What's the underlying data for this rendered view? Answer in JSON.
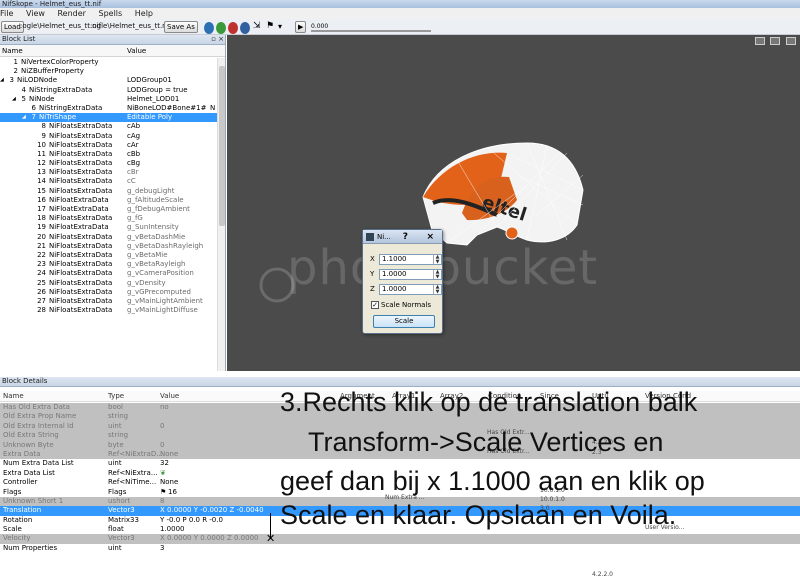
{
  "window": {
    "title": "NifSkope - Helmet_eus_tt.nif"
  },
  "menu": [
    "File",
    "View",
    "Render",
    "Spells",
    "Help"
  ],
  "toolbar": {
    "load_label": "Load",
    "load_path": ":ogle\\Helmet_eus_tt.nif",
    "save_path": ":ogle\\Helmet_eus_tt.nif",
    "save_as_label": "Save As",
    "time_value": "0.000"
  },
  "block_list": {
    "title": "Block List",
    "col_name": "Name",
    "col_value": "Value",
    "rows": [
      {
        "num": "1",
        "name": "NiVertexColorProperty",
        "value": "",
        "indent": 6
      },
      {
        "num": "2",
        "name": "NiZBufferProperty",
        "value": "",
        "indent": 6
      },
      {
        "num": "3",
        "name": "NiLODNode",
        "value": "LODGroup01",
        "indent": 2
      },
      {
        "num": "4",
        "name": "NiStringExtraData",
        "value": "LODGroup = true",
        "indent": 14
      },
      {
        "num": "5",
        "name": "NiNode",
        "value": "Helmet_LOD01",
        "indent": 14
      },
      {
        "num": "6",
        "name": "NiStringExtraData",
        "value": "NiBoneLOD#Bone#1#",
        "indent": 24
      },
      {
        "num": "7",
        "name": "NiTriShape",
        "value": "Editable Poly",
        "indent": 24
      },
      {
        "num": "8",
        "name": "NiFloatsExtraData",
        "value": "cAb",
        "indent": 34
      },
      {
        "num": "9",
        "name": "NiFloatsExtraData",
        "value": "cAg",
        "indent": 34
      },
      {
        "num": "10",
        "name": "NiFloatsExtraData",
        "value": "cAr",
        "indent": 34
      },
      {
        "num": "11",
        "name": "NiFloatsExtraData",
        "value": "cBb",
        "indent": 34
      },
      {
        "num": "12",
        "name": "NiFloatsExtraData",
        "value": "cBg",
        "indent": 34
      },
      {
        "num": "13",
        "name": "NiFloatsExtraData",
        "value": "cBr",
        "indent": 34
      },
      {
        "num": "14",
        "name": "NiFloatsExtraData",
        "value": "cC",
        "indent": 34
      },
      {
        "num": "15",
        "name": "NiFloatsExtraData",
        "value": "g_debugLight",
        "indent": 34
      },
      {
        "num": "16",
        "name": "NiFloatExtraData",
        "value": "g_fAltitudeScale",
        "indent": 34
      },
      {
        "num": "17",
        "name": "NiFloatExtraData",
        "value": "g_fDebugAmbient",
        "indent": 34
      },
      {
        "num": "18",
        "name": "NiFloatsExtraData",
        "value": "g_fG",
        "indent": 34
      },
      {
        "num": "19",
        "name": "NiFloatExtraData",
        "value": "g_SunIntensity",
        "indent": 34
      },
      {
        "num": "20",
        "name": "NiFloatsExtraData",
        "value": "g_vBetaDashMie",
        "indent": 34
      },
      {
        "num": "21",
        "name": "NiFloatsExtraData",
        "value": "g_vBetaDashRayleigh",
        "indent": 34
      },
      {
        "num": "22",
        "name": "NiFloatsExtraData",
        "value": "g_vBetaMie",
        "indent": 34
      },
      {
        "num": "23",
        "name": "NiFloatsExtraData",
        "value": "g_vBetaRayleigh",
        "indent": 34
      },
      {
        "num": "24",
        "name": "NiFloatsExtraData",
        "value": "g_vCameraPosition",
        "indent": 34
      },
      {
        "num": "25",
        "name": "NiFloatsExtraData",
        "value": "g_vDensity",
        "indent": 34
      },
      {
        "num": "26",
        "name": "NiFloatsExtraData",
        "value": "g_vGPrecomputed",
        "indent": 34
      },
      {
        "num": "27",
        "name": "NiFloatsExtraData",
        "value": "g_vMainLightAmbient",
        "indent": 34
      },
      {
        "num": "28",
        "name": "NiFloatsExtraData",
        "value": "g_vMainLightDiffuse",
        "indent": 34
      }
    ],
    "right_cut": "N"
  },
  "viewport": {
    "watermark": "photobucket"
  },
  "scale_dialog": {
    "title": "Ni...",
    "help": "?",
    "close": "×",
    "x_label": "X",
    "x_value": "1.1000",
    "y_label": "Y",
    "y_value": "1.0000",
    "z_label": "Z",
    "z_value": "1.0000",
    "normals_label": "Scale Normals",
    "button_label": "Scale"
  },
  "block_details": {
    "title": "Block Details",
    "col_name": "Name",
    "col_type": "Type",
    "col_value": "Value",
    "col_argument": "Argument",
    "col_array1": "Array1",
    "col_array2": "Array2",
    "col_condition": "Condition",
    "col_since": "Since",
    "col_until": "Until",
    "col_version": "Version Cond",
    "rows": [
      {
        "name": "Has Old Extra Data",
        "type": "bool",
        "value": "no",
        "style": "grey"
      },
      {
        "name": "Old Extra Prop Name",
        "type": "string",
        "value": "",
        "style": "grey"
      },
      {
        "name": "Old Extra Internal Id",
        "type": "uint",
        "value": "0",
        "style": "grey"
      },
      {
        "name": "Old Extra String",
        "type": "string",
        "value": "",
        "style": "grey"
      },
      {
        "name": "Unknown Byte",
        "type": "byte",
        "value": "0",
        "style": "grey"
      },
      {
        "name": "Extra Data",
        "type": "Ref<NiExtraD...",
        "value": "None",
        "style": "grey"
      },
      {
        "name": "Num Extra Data List",
        "type": "uint",
        "value": "32",
        "style": ""
      },
      {
        "name": "Extra Data List",
        "type": "Ref<NiExtra...",
        "value": "",
        "style": ""
      },
      {
        "name": "Controller",
        "type": "Ref<NiTime...",
        "value": "None",
        "style": ""
      },
      {
        "name": "Flags",
        "type": "Flags",
        "value": "16",
        "style": ""
      },
      {
        "name": "Unknown Short 1",
        "type": "ushort",
        "value": "8",
        "style": "grey"
      },
      {
        "name": "Translation",
        "type": "Vector3",
        "value": "X 0.0000 Y -0.0020 Z -0.0040",
        "style": "sel"
      },
      {
        "name": "Rotation",
        "type": "Matrix33",
        "value": "Y -0.0 P 0.0 R -0.0",
        "style": ""
      },
      {
        "name": "Scale",
        "type": "float",
        "value": "1.0000",
        "style": ""
      },
      {
        "name": "Velocity",
        "type": "Vector3",
        "value": "X 0.0000 Y 0.0000 Z 0.0000",
        "style": "grey"
      },
      {
        "name": "Num Properties",
        "type": "uint",
        "value": "3",
        "style": ""
      }
    ],
    "right_fragments": {
      "has_old_extra": "Has Old Extr...",
      "has_old_ext2": "Has Old Extr...",
      "num_extra": "Num Extra ...",
      "v1": "4.2.2.0",
      "v2": "2.3",
      "v3": "10.0.1.0",
      "v4": "10.0.1.0",
      "v5": "3.0",
      "v6": "4.2.2.0",
      "user_version": "User Versio..."
    }
  },
  "annotation": {
    "line1": "3.Rechts klik op de translation balk",
    "line2": "Transform->Scale Vertices en",
    "line3": "geef dan bij x 1.1000 aan en klik op",
    "line4": "Scale en klaar. Opslaan en Voila."
  }
}
